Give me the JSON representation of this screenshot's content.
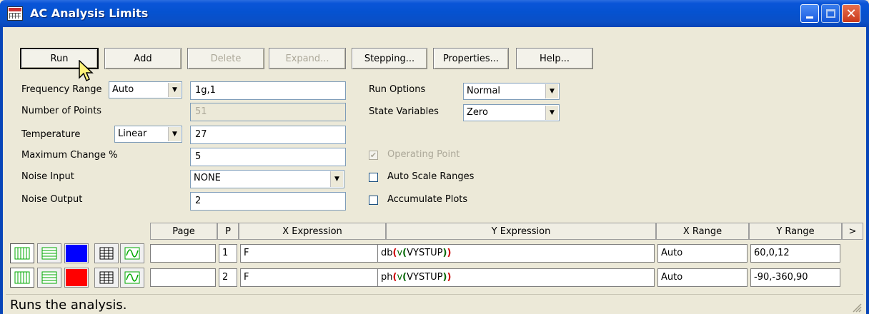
{
  "window": {
    "title": "AC Analysis Limits"
  },
  "toolbar": {
    "run": "Run",
    "add": "Add",
    "delete": "Delete",
    "expand": "Expand...",
    "stepping": "Stepping...",
    "properties": "Properties...",
    "help": "Help..."
  },
  "form": {
    "frequency_range_label": "Frequency Range",
    "frequency_range_mode": "Auto",
    "frequency_range_value": "1g,1",
    "number_of_points_label": "Number of Points",
    "number_of_points_value": "51",
    "temperature_label": "Temperature",
    "temperature_mode": "Linear",
    "temperature_value": "27",
    "max_change_label": "Maximum Change %",
    "max_change_value": "5",
    "noise_input_label": "Noise Input",
    "noise_input_value": "NONE",
    "noise_output_label": "Noise Output",
    "noise_output_value": "2",
    "run_options_label": "Run Options",
    "run_options_value": "Normal",
    "state_variables_label": "State Variables",
    "state_variables_value": "Zero",
    "operating_point_label": "Operating Point",
    "operating_point_checked": true,
    "auto_scale_label": "Auto Scale Ranges",
    "auto_scale_checked": false,
    "accumulate_plots_label": "Accumulate Plots",
    "accumulate_plots_checked": false
  },
  "grid": {
    "headers": [
      "Page",
      "P",
      "X Expression",
      "Y Expression",
      "X Range",
      "Y Range",
      ">"
    ],
    "rows": [
      {
        "color": "#0000ff",
        "page": "",
        "p": "1",
        "x_expr": "F",
        "y_expr_fn": "db",
        "y_expr_inner": "v",
        "y_expr_arg": "VYSTUP",
        "x_range": "Auto",
        "y_range": "60,0,12"
      },
      {
        "color": "#ff0000",
        "page": "",
        "p": "2",
        "x_expr": "F",
        "y_expr_fn": "ph",
        "y_expr_inner": "v",
        "y_expr_arg": "VYSTUP",
        "x_range": "Auto",
        "y_range": "-90,-360,90"
      }
    ]
  },
  "status": {
    "text": "Runs the analysis."
  }
}
